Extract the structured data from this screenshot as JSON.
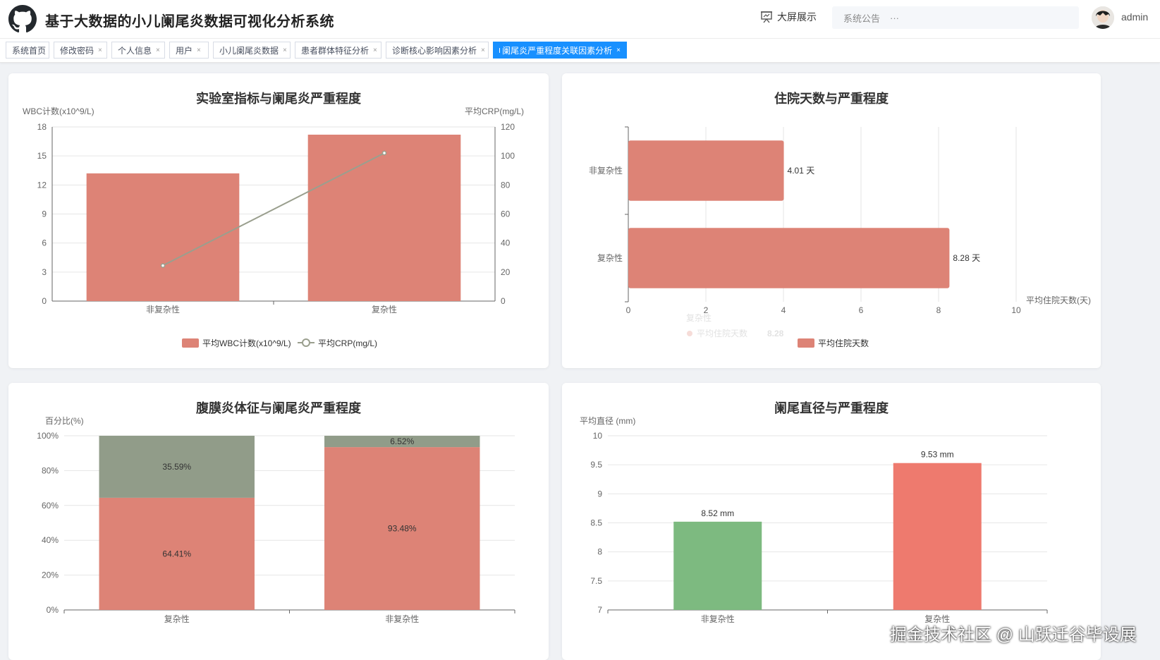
{
  "header": {
    "title": "基于大数据的小儿阑尾炎数据可视化分析系统",
    "bigscreen_label": "大屏展示",
    "notice_label": "系统公告",
    "notice_more": "···",
    "username": "admin"
  },
  "tabs": [
    {
      "label": "系统首页",
      "closable": false,
      "active": false
    },
    {
      "label": "修改密码",
      "closable": true,
      "active": false
    },
    {
      "label": "个人信息",
      "closable": true,
      "active": false
    },
    {
      "label": "用户",
      "closable": true,
      "active": false
    },
    {
      "label": "小儿阑尾炎数据",
      "closable": true,
      "active": false
    },
    {
      "label": "患者群体特征分析",
      "closable": true,
      "active": false
    },
    {
      "label": "诊断核心影响因素分析",
      "closable": true,
      "active": false
    },
    {
      "label": "阑尾炎严重程度关联因素分析",
      "closable": true,
      "active": true
    }
  ],
  "chart_data": [
    {
      "type": "bar",
      "title": "实验室指标与阑尾炎严重程度",
      "categories": [
        "非复杂性",
        "复杂性"
      ],
      "ylabel_left": "WBC计数(x10^9/L)",
      "ylabel_right": "平均CRP(mg/L)",
      "ylim_left": [
        0,
        18
      ],
      "yticks_left": [
        0,
        3,
        6,
        9,
        12,
        15,
        18
      ],
      "ylim_right": [
        0,
        120
      ],
      "yticks_right": [
        0,
        20,
        40,
        60,
        80,
        100,
        120
      ],
      "series": [
        {
          "name": "平均WBC计数(x10^9/L)",
          "kind": "bar",
          "axis": "left",
          "values": [
            13.2,
            17.2
          ],
          "color": "#dd8376"
        },
        {
          "name": "平均CRP(mg/L)",
          "kind": "line",
          "axis": "right",
          "values": [
            24.5,
            102
          ],
          "color": "#9a9f8e"
        }
      ],
      "grid": true,
      "legend": "bottom"
    },
    {
      "type": "bar",
      "orientation": "horizontal",
      "title": "住院天数与严重程度",
      "categories": [
        "非复杂性",
        "复杂性"
      ],
      "values": [
        4.01,
        8.28
      ],
      "value_labels": [
        "4.01 天",
        "8.28 天"
      ],
      "xlabel": "平均住院天数(天)",
      "xlim": [
        0,
        10
      ],
      "xticks": [
        0,
        2,
        4,
        6,
        8,
        10
      ],
      "series_name": "平均住院天数",
      "color": "#dd8376",
      "tooltip": {
        "title": "复杂性",
        "label": "平均住院天数",
        "value": "8.28"
      },
      "grid": true,
      "legend": "bottom"
    },
    {
      "type": "bar",
      "stacked": true,
      "title": "腹膜炎体征与阑尾炎严重程度",
      "categories": [
        "复杂性",
        "非复杂性"
      ],
      "ylabel": "百分比(%)",
      "ylim": [
        0,
        100
      ],
      "yticks": [
        "0%",
        "20%",
        "40%",
        "60%",
        "80%",
        "100%"
      ],
      "series": [
        {
          "values": [
            64.41,
            93.48
          ],
          "labels": [
            "64.41%",
            "93.48%"
          ],
          "color": "#dd8376"
        },
        {
          "values": [
            35.59,
            6.52
          ],
          "labels": [
            "35.59%",
            "6.52%"
          ],
          "color": "#919c89"
        }
      ],
      "grid": true
    },
    {
      "type": "bar",
      "title": "阑尾直径与严重程度",
      "categories": [
        "非复杂性",
        "复杂性"
      ],
      "values": [
        8.52,
        9.53
      ],
      "value_labels": [
        "8.52 mm",
        "9.53 mm"
      ],
      "colors": [
        "#7dba80",
        "#ee7a6e"
      ],
      "ylabel": "平均直径 (mm)",
      "ylim": [
        7,
        10
      ],
      "yticks": [
        "7",
        "7.5",
        "8",
        "8.5",
        "9",
        "9.5",
        "10"
      ],
      "grid": true
    }
  ],
  "watermark": "掘金技术社区 @ 山跃迁谷毕设展"
}
